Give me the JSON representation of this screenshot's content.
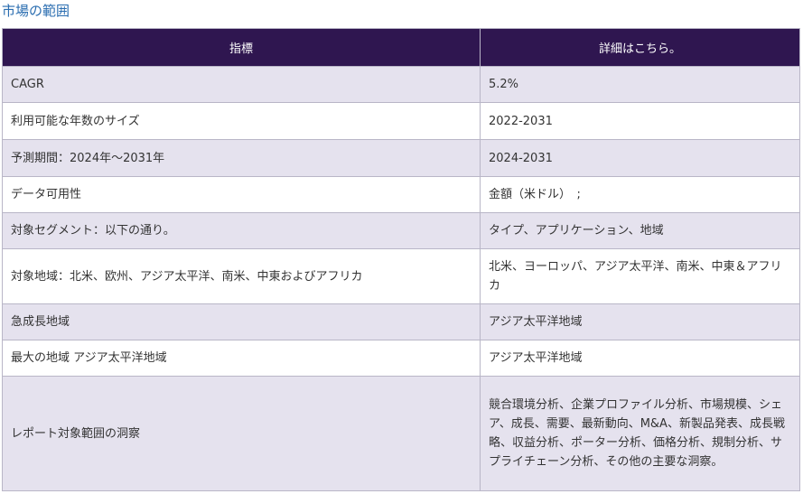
{
  "page": {
    "title": "市場の範囲"
  },
  "table": {
    "headers": [
      "指標",
      "詳細はこちら。"
    ],
    "rows": [
      {
        "label": "CAGR",
        "value": "5.2%"
      },
      {
        "label": "利用可能な年数のサイズ",
        "value": "2022-2031"
      },
      {
        "label": "予測期間：2024年～2031年",
        "value": "2024-2031"
      },
      {
        "label": "データ可用性",
        "value": "金額（米ドル）　;"
      },
      {
        "label": "対象セグメント：以下の通り。",
        "value": "タイプ、アプリケーション、地域"
      },
      {
        "label": "対象地域：北米、欧州、アジア太平洋、南米、中東およびアフリカ",
        "value": "北米、ヨーロッパ、アジア太平洋、南米、中東＆アフリカ"
      },
      {
        "label": "急成長地域",
        "value": "アジア太平洋地域"
      },
      {
        "label": "最大の地域 アジア太平洋地域",
        "value": "アジア太平洋地域"
      },
      {
        "label": "レポート対象範囲の洞察",
        "value": "競合環境分析、企業プロファイル分析、市場規模、シェア、成長、需要、最新動向、M&A、新製品発表、成長戦略、収益分析、ポーター分析、価格分析、規制分析、サプライチェーン分析、その他の主要な洞察。"
      }
    ]
  }
}
